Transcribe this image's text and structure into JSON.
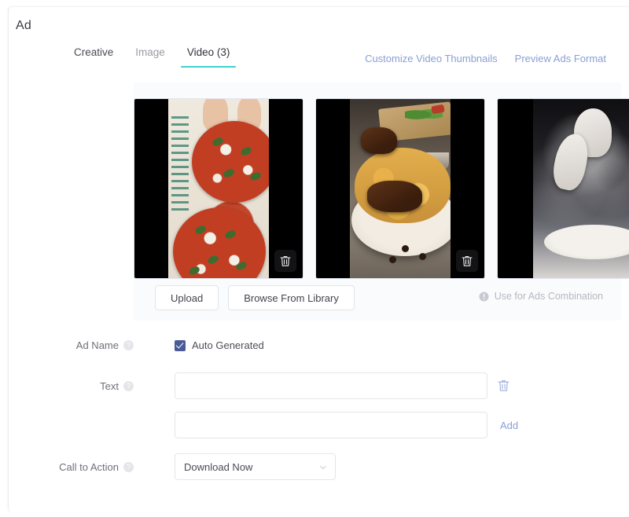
{
  "header": {
    "title": "Ad",
    "tabs": [
      {
        "label": "Creative",
        "active": false
      },
      {
        "label": "Image",
        "active": false
      },
      {
        "label": "Video (3)",
        "active": true
      }
    ],
    "links": [
      {
        "label": "Customize Video Thumbnails"
      },
      {
        "label": "Preview Ads Format"
      }
    ]
  },
  "media": {
    "thumbnails": [
      {
        "alt": "two margherita pizzas being plated",
        "delete_icon": "trash-icon"
      },
      {
        "alt": "chicken biryani on a white plate",
        "delete_icon": "trash-icon"
      },
      {
        "alt": "hands dusting flour over pizza dough",
        "delete_icon": "trash-icon"
      }
    ],
    "upload_label": "Upload",
    "browse_label": "Browse From Library",
    "combination_label": "Use for Ads Combination",
    "combination_icon": "info-icon"
  },
  "form": {
    "ad_name": {
      "label": "Ad Name",
      "help_icon": "help-icon",
      "checkbox_label": "Auto Generated",
      "checked": true
    },
    "text": {
      "label": "Text",
      "help_icon": "help-icon",
      "value_1": "",
      "placeholder_1": "",
      "delete_icon": "trash-icon",
      "value_2": "",
      "placeholder_2": "",
      "add_label": "Add"
    },
    "call_to_action": {
      "label": "Call to Action",
      "help_icon": "help-icon",
      "selected": "Download Now",
      "chevron_icon": "chevron-down-icon"
    }
  },
  "colors": {
    "accent_teal": "#3fd0cf",
    "link_blue": "#8b9fd6",
    "checkbox_blue": "#4a5b96",
    "panel_bg": "#fafbfd"
  }
}
